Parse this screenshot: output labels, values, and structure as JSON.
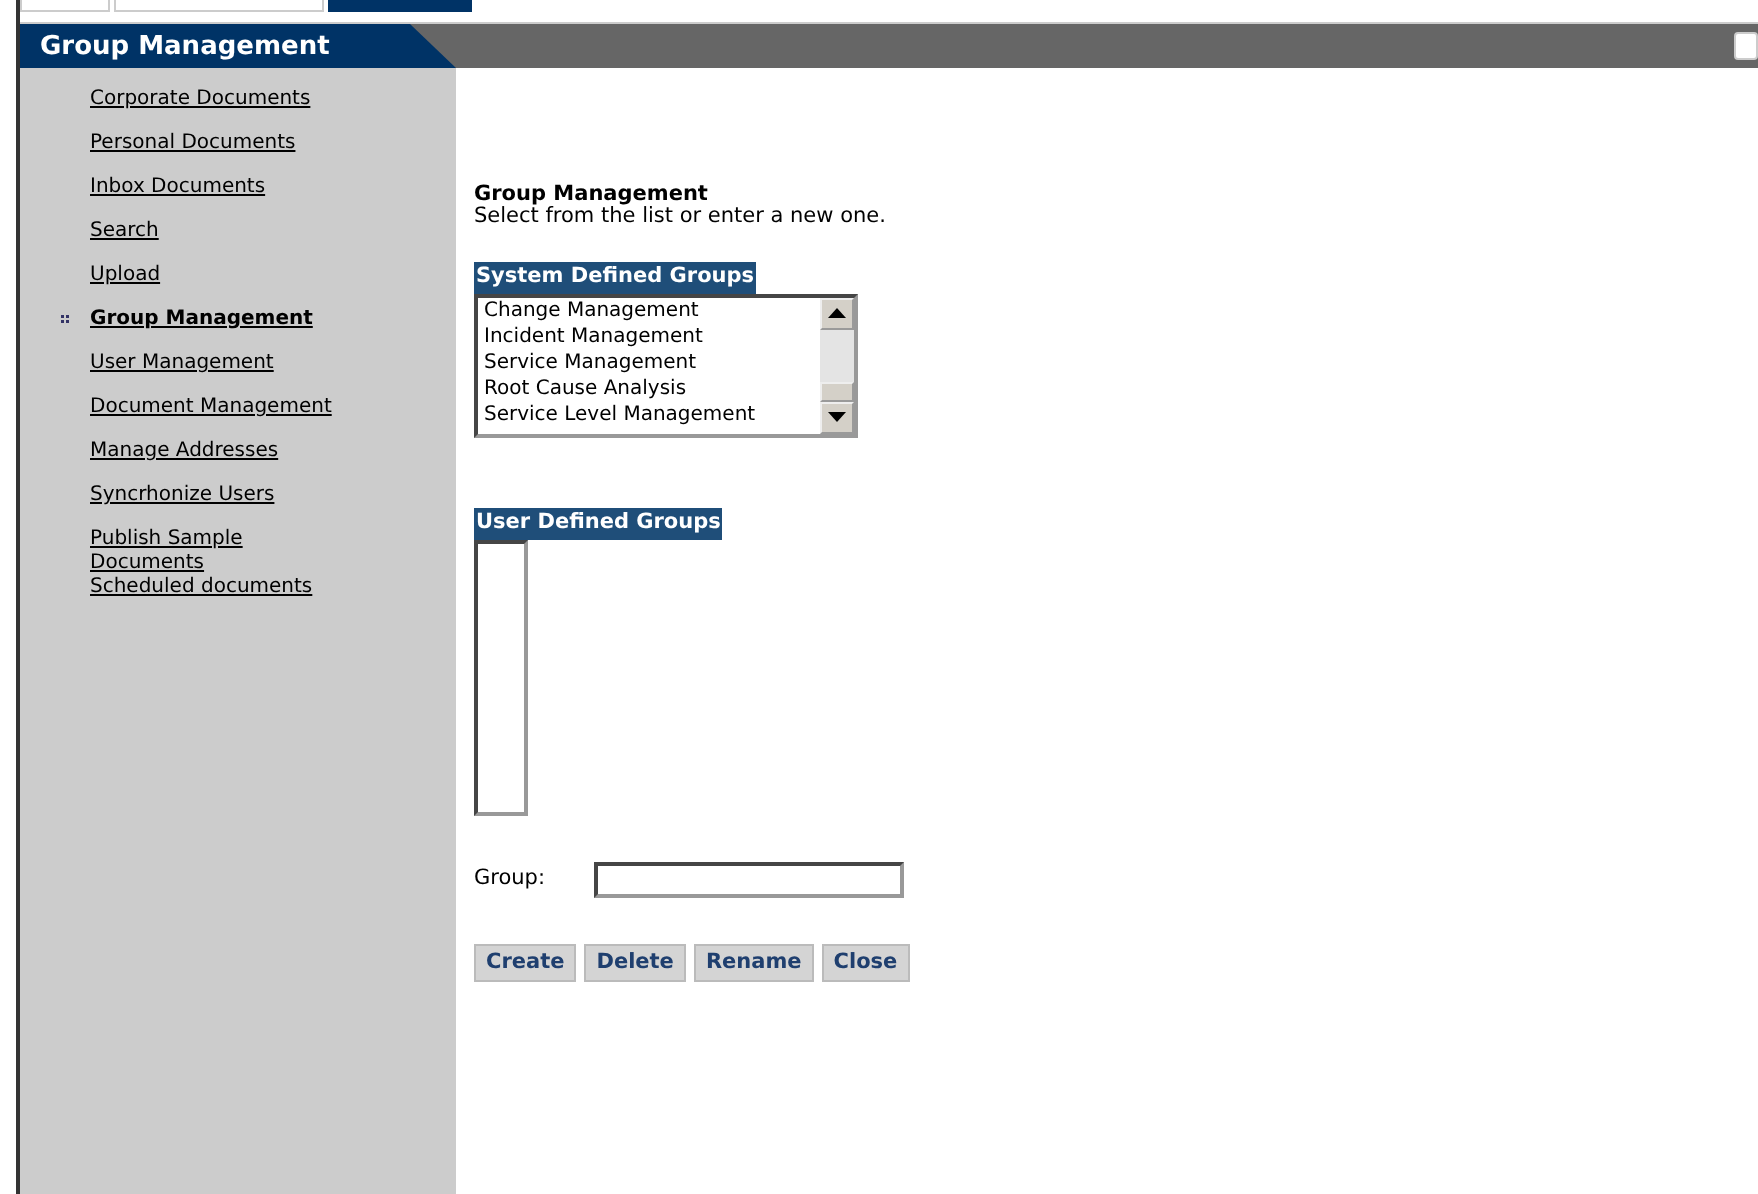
{
  "header": {
    "title": "Group Management"
  },
  "sidebar": {
    "items": [
      {
        "label": "Corporate Documents",
        "selected": false
      },
      {
        "label": "Personal Documents",
        "selected": false
      },
      {
        "label": "Inbox Documents",
        "selected": false
      },
      {
        "label": "Search",
        "selected": false
      },
      {
        "label": "Upload",
        "selected": false
      },
      {
        "label": "Group Management",
        "selected": true
      },
      {
        "label": "User Management",
        "selected": false
      },
      {
        "label": "Document Management",
        "selected": false
      },
      {
        "label": "Manage Addresses",
        "selected": false
      },
      {
        "label": "Syncrhonize Users",
        "selected": false
      },
      {
        "label": "Publish Sample Documents",
        "selected": false
      },
      {
        "label": "Scheduled documents",
        "selected": false
      }
    ]
  },
  "content": {
    "heading": "Group Management",
    "instructions": "Select from the list or enter a new one.",
    "system_groups": {
      "label": "System Defined Groups",
      "items": [
        "Change Management",
        "Incident Management",
        "Service Management",
        "Root Cause Analysis",
        "Service Level Management"
      ]
    },
    "user_groups": {
      "label": "User Defined Groups"
    },
    "group_field": {
      "label": "Group:"
    },
    "buttons": [
      "Create",
      "Delete",
      "Rename",
      "Close"
    ]
  }
}
